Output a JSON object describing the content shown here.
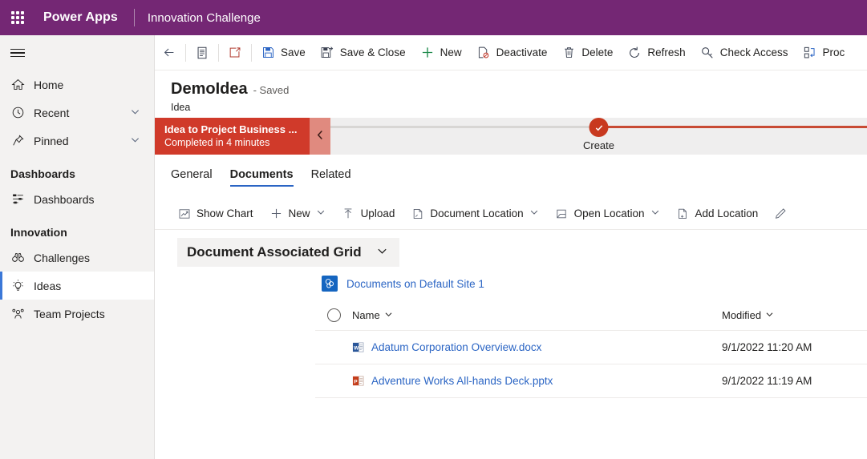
{
  "appbar": {
    "waffle_icon": "app-launcher-icon",
    "brand": "Power Apps",
    "environment": "Innovation Challenge"
  },
  "sidebar": {
    "hamburger_icon": "hamburger-menu-icon",
    "items": [
      {
        "label": "Home",
        "icon": "home-icon",
        "expandable": false,
        "selected": false
      },
      {
        "label": "Recent",
        "icon": "clock-icon",
        "expandable": true,
        "selected": false
      },
      {
        "label": "Pinned",
        "icon": "pin-icon",
        "expandable": true,
        "selected": false
      }
    ],
    "groups": [
      {
        "title": "Dashboards",
        "items": [
          {
            "label": "Dashboards",
            "icon": "dashboard-icon",
            "selected": false
          }
        ]
      },
      {
        "title": "Innovation",
        "items": [
          {
            "label": "Challenges",
            "icon": "binoculars-icon",
            "selected": false
          },
          {
            "label": "Ideas",
            "icon": "lightbulb-icon",
            "selected": true
          },
          {
            "label": "Team Projects",
            "icon": "people-icon",
            "selected": false
          }
        ]
      }
    ]
  },
  "commandbar": {
    "items": [
      {
        "label": "",
        "icon": "back-arrow-icon"
      },
      {
        "label": "",
        "icon": "form-icon"
      },
      {
        "label": "",
        "icon": "open-in-new-icon"
      },
      {
        "label": "Save",
        "icon": "save-icon"
      },
      {
        "label": "Save & Close",
        "icon": "save-and-close-icon"
      },
      {
        "label": "New",
        "icon": "plus-icon"
      },
      {
        "label": "Deactivate",
        "icon": "deactivate-icon"
      },
      {
        "label": "Delete",
        "icon": "trash-icon"
      },
      {
        "label": "Refresh",
        "icon": "refresh-icon"
      },
      {
        "label": "Check Access",
        "icon": "key-icon"
      },
      {
        "label": "Proc",
        "icon": "process-icon"
      }
    ]
  },
  "record": {
    "title": "DemoIdea",
    "saved_status": "- Saved",
    "entity": "Idea"
  },
  "process": {
    "stage_title": "Idea to Project Business ...",
    "stage_subtitle": "Completed in 4 minutes",
    "collapse_icon": "chevron-left-icon",
    "node_icon": "check-icon",
    "node_label": "Create",
    "stage_color": "#d03a2a",
    "node_color": "#c8391f"
  },
  "tabs": [
    {
      "label": "General",
      "active": false
    },
    {
      "label": "Documents",
      "active": true
    },
    {
      "label": "Related",
      "active": false
    }
  ],
  "subcommandbar": {
    "items": [
      {
        "label": "Show Chart",
        "icon": "chart-icon",
        "chevron": false
      },
      {
        "label": "New",
        "icon": "plus-icon",
        "chevron": true
      },
      {
        "label": "Upload",
        "icon": "upload-icon",
        "chevron": false
      },
      {
        "label": "Document Location",
        "icon": "document-location-icon",
        "chevron": true
      },
      {
        "label": "Open Location",
        "icon": "open-location-icon",
        "chevron": true
      },
      {
        "label": "Add Location",
        "icon": "add-location-icon",
        "chevron": false
      },
      {
        "label": "",
        "icon": "pencil-icon",
        "chevron": false
      }
    ]
  },
  "view_selector": {
    "label": "Document Associated Grid",
    "chevron_icon": "chevron-down-icon"
  },
  "location": {
    "site_icon": "sharepoint-icon",
    "link": "Documents on Default Site 1"
  },
  "grid": {
    "select_all_icon": "select-all-circle",
    "columns": [
      {
        "label": "Name",
        "sortable": true
      },
      {
        "label": "Modified",
        "sortable": true
      }
    ],
    "rows": [
      {
        "icon": "word-document-icon",
        "name": "Adatum Corporation Overview.docx",
        "modified": "9/1/2022 11:20 AM"
      },
      {
        "icon": "powerpoint-document-icon",
        "name": "Adventure Works All-hands Deck.pptx",
        "modified": "9/1/2022 11:19 AM"
      }
    ]
  },
  "colors": {
    "brand_purple": "#742774",
    "accent_blue": "#2b65c4",
    "process_red": "#d03a2a",
    "save_blue": "#2b65c4",
    "new_green": "#107c41",
    "delete_red": "#a4262c"
  }
}
